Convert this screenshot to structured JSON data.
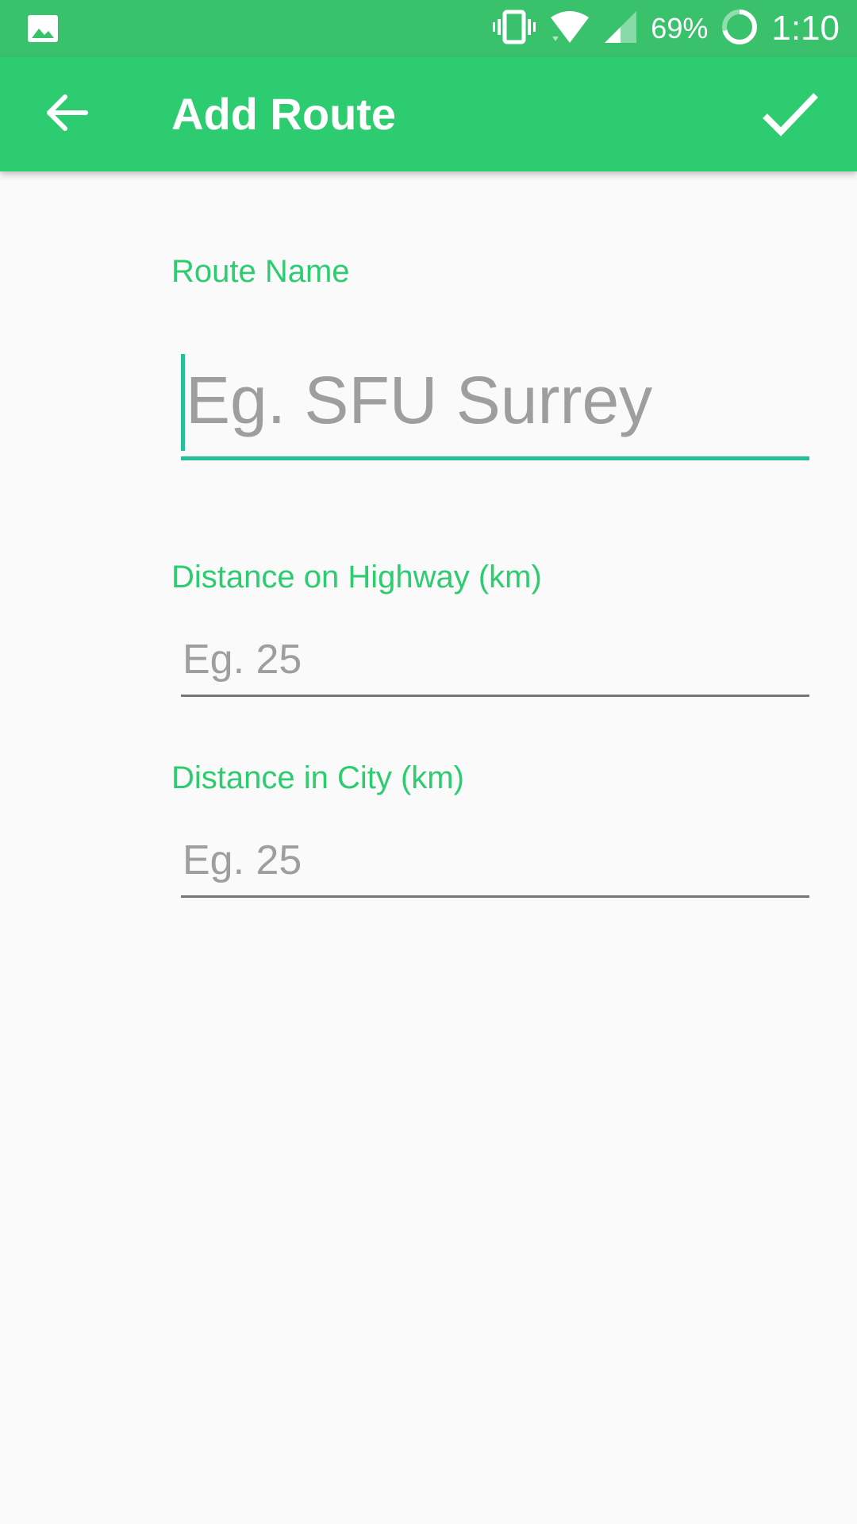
{
  "status_bar": {
    "battery_percent": "69%",
    "time": "1:10",
    "icons": [
      "gallery-icon",
      "vibrate-icon",
      "wifi-icon",
      "signal-icon",
      "battery-icon"
    ]
  },
  "app_bar": {
    "title": "Add Route",
    "back_icon": "arrow-back-icon",
    "done_icon": "check-icon"
  },
  "form": {
    "route_name": {
      "label": "Route Name",
      "value": "",
      "placeholder": "Eg. SFU Surrey"
    },
    "distance_highway": {
      "label": "Distance on Highway (km)",
      "value": "",
      "placeholder": "Eg. 25"
    },
    "distance_city": {
      "label": "Distance in City (km)",
      "value": "",
      "placeholder": "Eg. 25"
    }
  },
  "colors": {
    "status_bar": "#3ac16b",
    "app_bar": "#2ecc71",
    "label": "#2ecc71",
    "focus_underline": "#26bf99",
    "placeholder": "#9e9e9e",
    "underline": "#757575",
    "background": "#fafafa"
  }
}
